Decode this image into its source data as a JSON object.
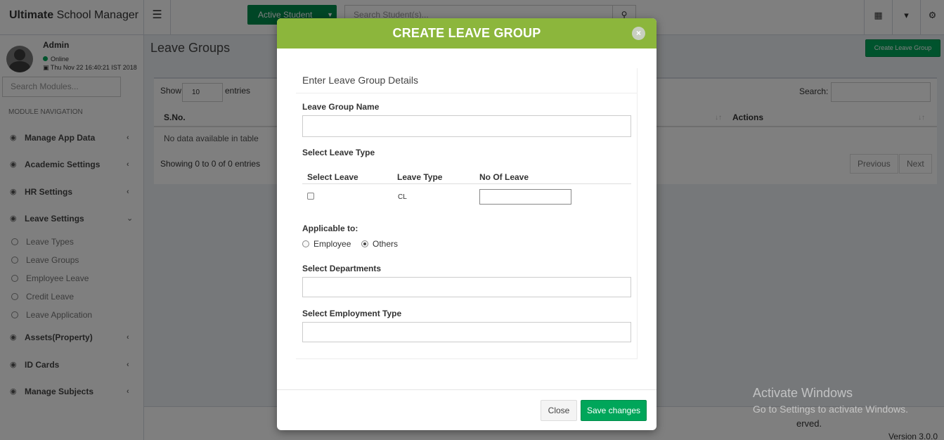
{
  "app": {
    "brand_bold": "Ultimate",
    "brand_rest": "School Manager",
    "active_student_label": "Active Student",
    "search_placeholder": "Search Student(s)..."
  },
  "user": {
    "name": "Admin",
    "status": "Online",
    "datetime": "Thu Nov 22 16:40:21 IST 2018"
  },
  "sidebar": {
    "search_placeholder": "Search Modules...",
    "nav_title": "MODULE NAVIGATION",
    "items": [
      {
        "label": "Manage App Data"
      },
      {
        "label": "Academic Settings"
      },
      {
        "label": "HR Settings"
      },
      {
        "label": "Leave Settings"
      },
      {
        "label": "Assets(Property)"
      },
      {
        "label": "ID Cards"
      },
      {
        "label": "Manage Subjects"
      }
    ],
    "leave_sub_items": [
      {
        "label": "Leave Types"
      },
      {
        "label": "Leave Groups"
      },
      {
        "label": "Employee Leave"
      },
      {
        "label": "Credit Leave"
      },
      {
        "label": "Leave Application"
      }
    ]
  },
  "page": {
    "title": "Leave Groups",
    "create_button": "Create Leave Group",
    "show_label": "Show",
    "entries_value": "10",
    "entries_label": "entries",
    "search_label": "Search:",
    "columns": [
      "S.No.",
      "Actions"
    ],
    "empty_text": "No data available in table",
    "showing_text": "Showing 0 to 0 of 0 entries",
    "previous": "Previous",
    "next": "Next"
  },
  "footer": {
    "text_fragment": "erved.",
    "version": "Version 3.0.0"
  },
  "modal": {
    "title": "CREATE LEAVE GROUP",
    "close_icon": "×",
    "panel_title": "Enter Leave Group Details",
    "leave_group_name_label": "Leave Group Name",
    "select_leave_type_label": "Select Leave Type",
    "table_headers": [
      "Select Leave",
      "Leave Type",
      "No Of Leave"
    ],
    "leave_rows": [
      {
        "checked": false,
        "type": "CL",
        "count": ""
      }
    ],
    "applicable_label": "Applicable to:",
    "applicable_options": [
      {
        "label": "Employee",
        "selected": false
      },
      {
        "label": "Others",
        "selected": true
      }
    ],
    "select_departments_label": "Select Departments",
    "select_employment_type_label": "Select Employment Type",
    "close_button": "Close",
    "save_button": "Save changes"
  },
  "watermark": {
    "line1": "Activate Windows",
    "line2": "Go to Settings to activate Windows."
  },
  "colors": {
    "modal_header": "#8cb63c",
    "primary_green": "#00a65a",
    "dark_green": "#008d4c"
  }
}
